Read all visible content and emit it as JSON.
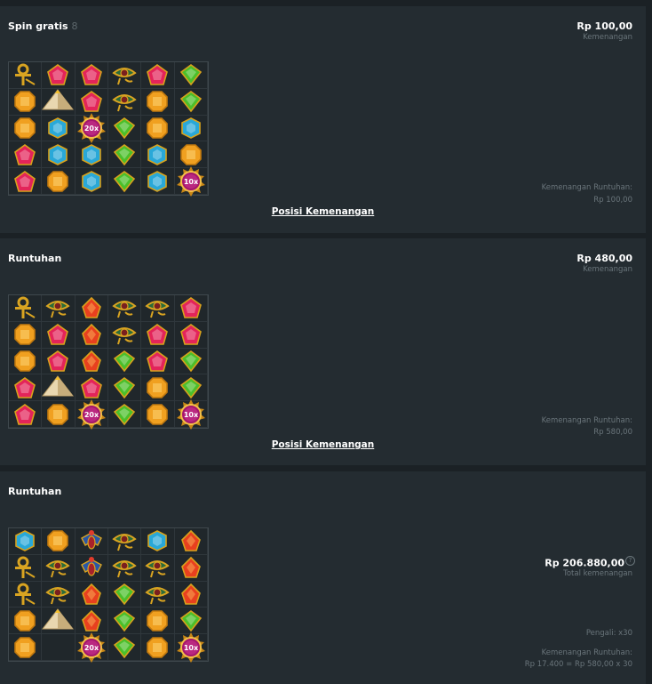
{
  "panels": [
    {
      "title": "Spin gratis",
      "count": "8",
      "amount": "Rp 100,00",
      "amount_label": "Kemenangan",
      "cascade_label": "Kemenangan Runtuhan:",
      "cascade_value": "Rp 100,00",
      "link": "Posisi Kemenangan",
      "grid": [
        [
          "ankh",
          "red-gem",
          "red-gem",
          "eye",
          "red-gem",
          "green-gem"
        ],
        [
          "orange-gem",
          "pyramid",
          "red-gem",
          "eye",
          "orange-gem",
          "green-gem"
        ],
        [
          "orange-gem",
          "blue-gem",
          "mult-20x",
          "green-gem",
          "orange-gem",
          "blue-gem"
        ],
        [
          "red-gem",
          "blue-gem",
          "blue-gem",
          "green-gem",
          "blue-gem",
          "orange-gem"
        ],
        [
          "red-gem",
          "orange-gem",
          "blue-gem",
          "green-gem",
          "blue-gem",
          "mult-10x"
        ]
      ]
    },
    {
      "title": "Runtuhan",
      "amount": "Rp 480,00",
      "amount_label": "Kemenangan",
      "cascade_label": "Kemenangan Runtuhan:",
      "cascade_value": "Rp 580,00",
      "link": "Posisi Kemenangan",
      "grid": [
        [
          "ankh",
          "eye",
          "fire-gem",
          "eye",
          "eye",
          "red-gem"
        ],
        [
          "orange-gem",
          "red-gem",
          "fire-gem",
          "eye",
          "red-gem",
          "red-gem"
        ],
        [
          "orange-gem",
          "red-gem",
          "fire-gem",
          "green-gem",
          "red-gem",
          "green-gem"
        ],
        [
          "red-gem",
          "pyramid",
          "red-gem",
          "green-gem",
          "orange-gem",
          "green-gem"
        ],
        [
          "red-gem",
          "orange-gem",
          "mult-20x",
          "green-gem",
          "orange-gem",
          "mult-10x"
        ]
      ]
    },
    {
      "title": "Runtuhan",
      "total_amount": "Rp 206.880,00",
      "total_label": "Total kemenangan",
      "help_icon": "?",
      "multiplier_label": "Pengali: x30",
      "cascade_label": "Kemenangan Runtuhan:",
      "cascade_value": "Rp 17.400 = Rp 580,00 x 30",
      "grid": [
        [
          "blue-gem",
          "orange-gem",
          "scarab",
          "eye",
          "blue-gem",
          "fire-gem"
        ],
        [
          "ankh",
          "eye",
          "scarab",
          "eye",
          "eye",
          "fire-gem"
        ],
        [
          "ankh",
          "eye",
          "fire-gem",
          "green-gem",
          "eye",
          "fire-gem"
        ],
        [
          "orange-gem",
          "pyramid",
          "fire-gem",
          "green-gem",
          "orange-gem",
          "green-gem"
        ],
        [
          "orange-gem",
          "mult-20x",
          "green-gem",
          "orange-gem",
          "mult-10x"
        ]
      ]
    }
  ],
  "multiplier_labels": {
    "mult-20x": "20x",
    "mult-10x": "10x"
  },
  "colors": {
    "background": "#1b2125",
    "panel": "#242c31",
    "muted_text": "#6a757b",
    "red_gem": "#e3245a",
    "green_gem": "#4bbf2a",
    "blue_gem": "#29a8d8",
    "orange_gem": "#f0a020",
    "gold": "#d9a421",
    "multiplier_orb": "#a3166d"
  }
}
